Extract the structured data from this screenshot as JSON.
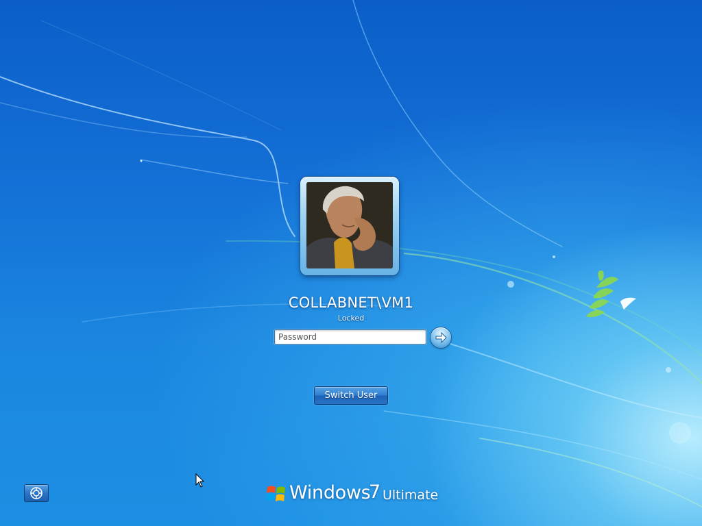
{
  "login": {
    "username": "COLLABNET\\VM1",
    "status": "Locked",
    "password_placeholder": "Password",
    "switch_user_label": "Switch User"
  },
  "branding": {
    "windows": "Windows",
    "version": "7",
    "edition": "Ultimate"
  },
  "icons": {
    "submit": "arrow-right-icon",
    "ease_of_access": "ease-of-access-icon",
    "logo": "windows-flag-icon"
  },
  "colors": {
    "background_top": "#0b5ec9",
    "background_glow": "#bff0ff",
    "button": "#2f7ed1"
  }
}
